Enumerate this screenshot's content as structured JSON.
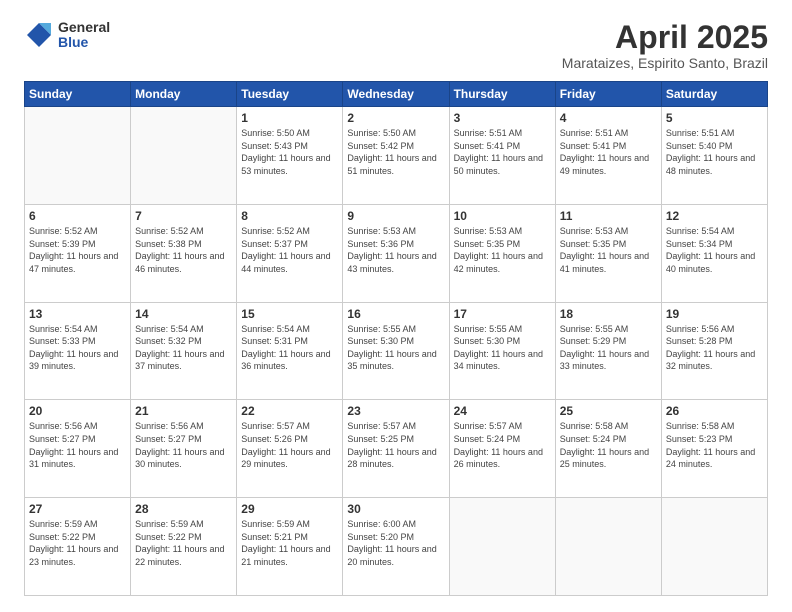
{
  "logo": {
    "general": "General",
    "blue": "Blue"
  },
  "title": "April 2025",
  "location": "Marataizes, Espirito Santo, Brazil",
  "weekdays": [
    "Sunday",
    "Monday",
    "Tuesday",
    "Wednesday",
    "Thursday",
    "Friday",
    "Saturday"
  ],
  "days": [
    {
      "day": "",
      "info": ""
    },
    {
      "day": "",
      "info": ""
    },
    {
      "day": "1",
      "info": "Sunrise: 5:50 AM\nSunset: 5:43 PM\nDaylight: 11 hours and 53 minutes."
    },
    {
      "day": "2",
      "info": "Sunrise: 5:50 AM\nSunset: 5:42 PM\nDaylight: 11 hours and 51 minutes."
    },
    {
      "day": "3",
      "info": "Sunrise: 5:51 AM\nSunset: 5:41 PM\nDaylight: 11 hours and 50 minutes."
    },
    {
      "day": "4",
      "info": "Sunrise: 5:51 AM\nSunset: 5:41 PM\nDaylight: 11 hours and 49 minutes."
    },
    {
      "day": "5",
      "info": "Sunrise: 5:51 AM\nSunset: 5:40 PM\nDaylight: 11 hours and 48 minutes."
    },
    {
      "day": "6",
      "info": "Sunrise: 5:52 AM\nSunset: 5:39 PM\nDaylight: 11 hours and 47 minutes."
    },
    {
      "day": "7",
      "info": "Sunrise: 5:52 AM\nSunset: 5:38 PM\nDaylight: 11 hours and 46 minutes."
    },
    {
      "day": "8",
      "info": "Sunrise: 5:52 AM\nSunset: 5:37 PM\nDaylight: 11 hours and 44 minutes."
    },
    {
      "day": "9",
      "info": "Sunrise: 5:53 AM\nSunset: 5:36 PM\nDaylight: 11 hours and 43 minutes."
    },
    {
      "day": "10",
      "info": "Sunrise: 5:53 AM\nSunset: 5:35 PM\nDaylight: 11 hours and 42 minutes."
    },
    {
      "day": "11",
      "info": "Sunrise: 5:53 AM\nSunset: 5:35 PM\nDaylight: 11 hours and 41 minutes."
    },
    {
      "day": "12",
      "info": "Sunrise: 5:54 AM\nSunset: 5:34 PM\nDaylight: 11 hours and 40 minutes."
    },
    {
      "day": "13",
      "info": "Sunrise: 5:54 AM\nSunset: 5:33 PM\nDaylight: 11 hours and 39 minutes."
    },
    {
      "day": "14",
      "info": "Sunrise: 5:54 AM\nSunset: 5:32 PM\nDaylight: 11 hours and 37 minutes."
    },
    {
      "day": "15",
      "info": "Sunrise: 5:54 AM\nSunset: 5:31 PM\nDaylight: 11 hours and 36 minutes."
    },
    {
      "day": "16",
      "info": "Sunrise: 5:55 AM\nSunset: 5:30 PM\nDaylight: 11 hours and 35 minutes."
    },
    {
      "day": "17",
      "info": "Sunrise: 5:55 AM\nSunset: 5:30 PM\nDaylight: 11 hours and 34 minutes."
    },
    {
      "day": "18",
      "info": "Sunrise: 5:55 AM\nSunset: 5:29 PM\nDaylight: 11 hours and 33 minutes."
    },
    {
      "day": "19",
      "info": "Sunrise: 5:56 AM\nSunset: 5:28 PM\nDaylight: 11 hours and 32 minutes."
    },
    {
      "day": "20",
      "info": "Sunrise: 5:56 AM\nSunset: 5:27 PM\nDaylight: 11 hours and 31 minutes."
    },
    {
      "day": "21",
      "info": "Sunrise: 5:56 AM\nSunset: 5:27 PM\nDaylight: 11 hours and 30 minutes."
    },
    {
      "day": "22",
      "info": "Sunrise: 5:57 AM\nSunset: 5:26 PM\nDaylight: 11 hours and 29 minutes."
    },
    {
      "day": "23",
      "info": "Sunrise: 5:57 AM\nSunset: 5:25 PM\nDaylight: 11 hours and 28 minutes."
    },
    {
      "day": "24",
      "info": "Sunrise: 5:57 AM\nSunset: 5:24 PM\nDaylight: 11 hours and 26 minutes."
    },
    {
      "day": "25",
      "info": "Sunrise: 5:58 AM\nSunset: 5:24 PM\nDaylight: 11 hours and 25 minutes."
    },
    {
      "day": "26",
      "info": "Sunrise: 5:58 AM\nSunset: 5:23 PM\nDaylight: 11 hours and 24 minutes."
    },
    {
      "day": "27",
      "info": "Sunrise: 5:59 AM\nSunset: 5:22 PM\nDaylight: 11 hours and 23 minutes."
    },
    {
      "day": "28",
      "info": "Sunrise: 5:59 AM\nSunset: 5:22 PM\nDaylight: 11 hours and 22 minutes."
    },
    {
      "day": "29",
      "info": "Sunrise: 5:59 AM\nSunset: 5:21 PM\nDaylight: 11 hours and 21 minutes."
    },
    {
      "day": "30",
      "info": "Sunrise: 6:00 AM\nSunset: 5:20 PM\nDaylight: 11 hours and 20 minutes."
    },
    {
      "day": "",
      "info": ""
    },
    {
      "day": "",
      "info": ""
    },
    {
      "day": "",
      "info": ""
    }
  ]
}
